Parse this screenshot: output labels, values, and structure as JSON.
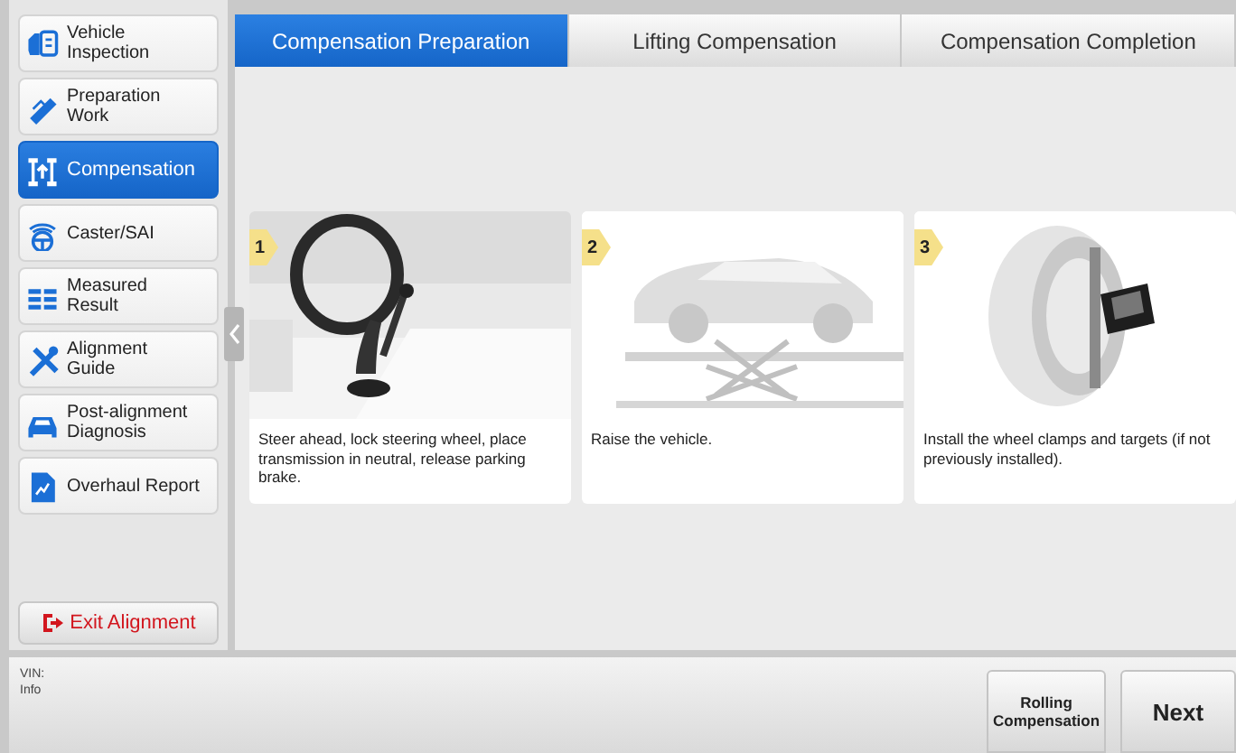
{
  "sidebar": {
    "items": [
      {
        "label": "Vehicle\nInspection",
        "selected": false
      },
      {
        "label": "Preparation\nWork",
        "selected": false
      },
      {
        "label": "Compensation",
        "selected": true
      },
      {
        "label": "Caster/SAI",
        "selected": false
      },
      {
        "label": "Measured\nResult",
        "selected": false
      },
      {
        "label": "Alignment\nGuide",
        "selected": false
      },
      {
        "label": "Post-alignment\nDiagnosis",
        "selected": false
      },
      {
        "label": "Overhaul Report",
        "selected": false
      }
    ],
    "exit_button": "Exit Alignment"
  },
  "tabs": [
    {
      "label": "Compensation Preparation",
      "selected": true
    },
    {
      "label": "Lifting Compensation",
      "selected": false
    },
    {
      "label": "Compensation Completion",
      "selected": false
    }
  ],
  "steps": [
    {
      "number": "1",
      "text": "Steer ahead, lock steering wheel, place transmission in neutral, release parking brake.",
      "kind": "interior"
    },
    {
      "number": "2",
      "text": "Raise the vehicle.",
      "kind": "lift"
    },
    {
      "number": "3",
      "text": "Install the wheel clamps and targets (if not previously installed).",
      "kind": "wheel"
    }
  ],
  "status_bar": {
    "vin_label": "VIN:",
    "info_label": "Info",
    "buttons": [
      "Rolling Compensation",
      "Next"
    ]
  }
}
